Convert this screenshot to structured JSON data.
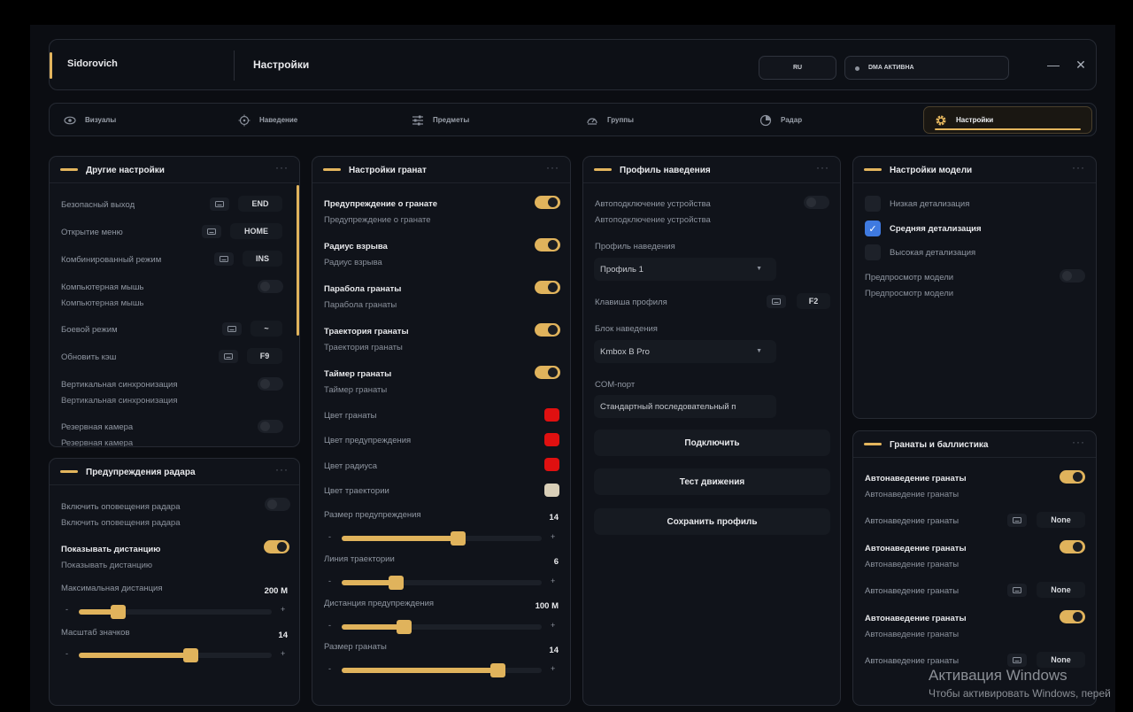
{
  "app": {
    "name": "Sidorovich",
    "page_title": "Настройки",
    "lang": "RU",
    "status": "DMA АКТИВНА"
  },
  "window": {
    "minimize_icon": "minimize-icon",
    "close_icon": "close-icon"
  },
  "tabs": [
    {
      "label": "Визуалы",
      "icon": "eye-icon"
    },
    {
      "label": "Наведение",
      "icon": "crosshair-icon"
    },
    {
      "label": "Предметы",
      "icon": "sliders-icon"
    },
    {
      "label": "Группы",
      "icon": "gauge-icon"
    },
    {
      "label": "Радар",
      "icon": "radar-icon"
    },
    {
      "label": "Настройки",
      "icon": "gear-icon",
      "active": true
    }
  ],
  "other": {
    "title": "Другие настройки",
    "rows": [
      {
        "label": "Безопасный выход",
        "key": "END"
      },
      {
        "label": "Открытие меню",
        "key": "HOME"
      },
      {
        "label": "Комбинированный режим",
        "key": "INS"
      },
      {
        "label": "Компьютерная мышь",
        "sub": "Компьютерная мышь",
        "toggle": false
      },
      {
        "label": "Боевой режим",
        "key": "~"
      },
      {
        "label": "Обновить кэш",
        "key": "F9"
      },
      {
        "label": "Вертикальная синхронизация",
        "sub": "Вертикальная синхронизация",
        "toggle": false
      },
      {
        "label": "Резервная камера",
        "sub": "Резервная камера",
        "toggle": false
      }
    ]
  },
  "radar": {
    "title": "Предупреждения радара",
    "enable_label": "Включить оповещения радара",
    "enable_sub": "Включить оповещения радара",
    "enable_on": false,
    "distance_label": "Показывать дистанцию",
    "distance_sub": "Показывать дистанцию",
    "distance_on": true,
    "max_label": "Максимальная дистанция",
    "max_value": "200 M",
    "max_fraction": 0.2,
    "scale_label": "Масштаб значков",
    "scale_value": "14",
    "scale_fraction": 0.58
  },
  "grenades": {
    "title": "Настройки гранат",
    "toggles": [
      {
        "label": "Предупреждение о гранате",
        "sub": "Предупреждение о гранате",
        "on": true
      },
      {
        "label": "Радиус взрыва",
        "sub": "Радиус взрыва",
        "on": true
      },
      {
        "label": "Парабола гранаты",
        "sub": "Парабола гранаты",
        "on": true
      },
      {
        "label": "Траектория гранаты",
        "sub": "Траектория гранаты",
        "on": true
      },
      {
        "label": "Таймер гранаты",
        "sub": "Таймер гранаты",
        "on": true
      }
    ],
    "colors": [
      {
        "label": "Цвет гранаты",
        "color": "#e01010"
      },
      {
        "label": "Цвет предупреждения",
        "color": "#e01010"
      },
      {
        "label": "Цвет радиуса",
        "color": "#e01010"
      },
      {
        "label": "Цвет траектории",
        "color": "#d9cfb8"
      }
    ],
    "sliders": [
      {
        "label": "Размер предупреждения",
        "value": "14",
        "fraction": 0.58
      },
      {
        "label": "Линия траектории",
        "value": "6",
        "fraction": 0.27
      },
      {
        "label": "Дистанция предупреждения",
        "value": "100 M",
        "fraction": 0.31
      },
      {
        "label": "Размер гранаты",
        "value": "14",
        "fraction": 0.78
      }
    ]
  },
  "aim": {
    "title": "Профиль наведения",
    "auto_label": "Автоподключение устройства",
    "auto_sub": "Автоподключение устройства",
    "auto_on": false,
    "profile_label": "Профиль наведения",
    "profile_value": "Профиль 1",
    "key_label": "Клавиша профиля",
    "key_value": "F2",
    "block_label": "Блок наведения",
    "block_value": "Kmbox B Pro",
    "com_label": "COM-порт",
    "com_value": "Стандартный последовательный п",
    "connect": "Подключить",
    "test": "Тест движения",
    "save": "Сохранить профиль"
  },
  "model": {
    "title": "Настройки модели",
    "options": [
      {
        "label": "Низкая детализация",
        "checked": false
      },
      {
        "label": "Средняя детализация",
        "checked": true
      },
      {
        "label": "Высокая детализация",
        "checked": false
      }
    ],
    "preview_label": "Предпросмотр модели",
    "preview_sub": "Предпросмотр модели",
    "preview_on": false
  },
  "ballistics": {
    "title": "Гранаты и баллистика",
    "groups": [
      {
        "label": "Автонаведение гранаты",
        "sub": "Автонаведение гранаты",
        "on": true,
        "key_label": "Автонаведение гранаты",
        "key": "None"
      },
      {
        "label": "Автонаведение гранаты",
        "sub": "Автонаведение гранаты",
        "on": true,
        "key_label": "Автонаведение гранаты",
        "key": "None"
      },
      {
        "label": "Автонаведение гранаты",
        "sub": "Автонаведение гранаты",
        "on": true,
        "key_label": "Автонаведение гранаты",
        "key": "None"
      }
    ]
  },
  "activation": {
    "line1": "Активация Windows",
    "line2": "Чтобы активировать Windows, перей"
  }
}
